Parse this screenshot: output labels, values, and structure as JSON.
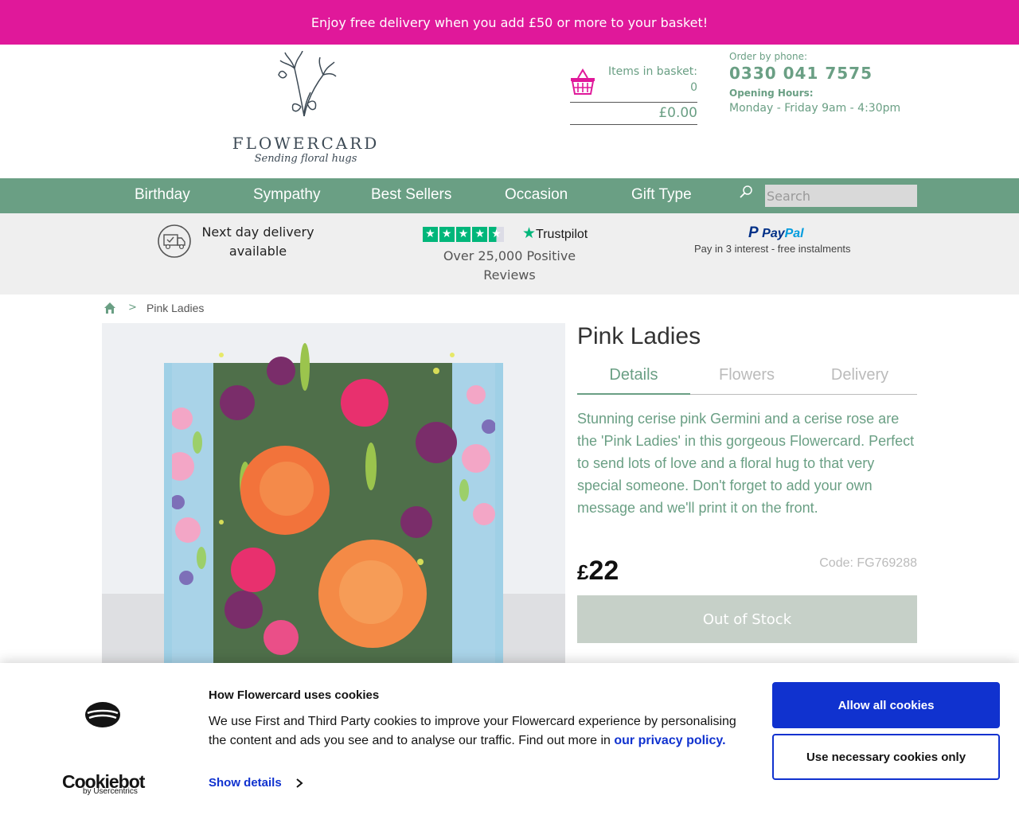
{
  "promo_bar": {
    "text": "Enjoy free delivery when you add £50 or more to your basket!"
  },
  "brand": {
    "name": "FLOWERCARD",
    "tagline": "Sending floral hugs"
  },
  "basket": {
    "label": "Items in basket:",
    "count": "0",
    "total": "£0.00",
    "icon": "basket-icon"
  },
  "contact": {
    "order_label": "Order by phone:",
    "phone": "0330 041 7575",
    "hours_label": "Opening Hours:",
    "hours": "Monday - Friday 9am - 4:30pm"
  },
  "nav": {
    "items": [
      {
        "label": "Birthday"
      },
      {
        "label": "Sympathy"
      },
      {
        "label": "Best Sellers"
      },
      {
        "label": "Occasion"
      },
      {
        "label": "Gift Type"
      }
    ],
    "search_placeholder": "Search"
  },
  "usp": {
    "delivery": "Next day delivery available",
    "trustpilot_brand": "Trustpilot",
    "trustpilot_rating_stars": 4.5,
    "reviews": "Over 25,000 Positive Reviews",
    "paypal_brand_pay": "Pay",
    "paypal_brand_pal": "Pal",
    "paypal_text": "Pay in 3 interest - free instalments"
  },
  "breadcrumb": {
    "current": "Pink Ladies",
    "separator": ">"
  },
  "product": {
    "title": "Pink Ladies",
    "tabs": [
      {
        "label": "Details",
        "active": true
      },
      {
        "label": "Flowers",
        "active": false
      },
      {
        "label": "Delivery",
        "active": false
      }
    ],
    "description": "Stunning cerise pink Germini and a cerise rose are the 'Pink Ladies' in this gorgeous Flowercard. Perfect to send lots of love and a floral hug to that very special someone. Don't forget to add your own message and we'll print it on the front.",
    "price_currency": "£",
    "price_amount": "22",
    "code": "Code: FG769288",
    "stock_button": "Out of Stock"
  },
  "cookie_banner": {
    "brand": "Cookiebot",
    "brand_sub": "by Usercentrics",
    "title": "How Flowercard uses cookies",
    "text": "We use First and Third Party cookies to improve your Flowercard experience by personalising the content and ads you see and to analyse our traffic. Find out more in",
    "link": "our privacy policy.",
    "show_details": "Show details",
    "allow_all": "Allow all cookies",
    "necessary_only": "Use necessary cookies only"
  },
  "colors": {
    "promo": "#e0189a",
    "brand_green": "#6a9f84",
    "cookie_blue": "#1032cf",
    "oos_button": "#c6d0c8",
    "trustpilot_green": "#00b67a",
    "paypal_dark": "#003087",
    "paypal_light": "#009cde"
  }
}
